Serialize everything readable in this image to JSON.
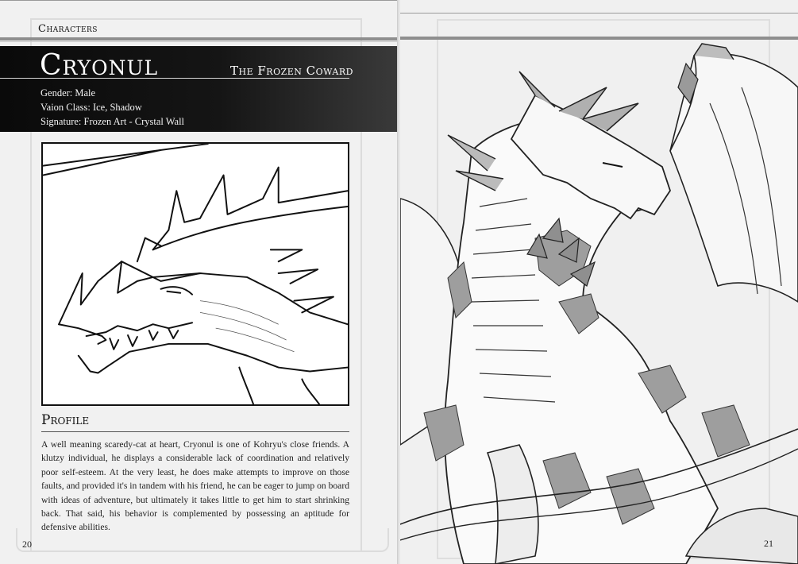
{
  "left_page": {
    "section": "Characters",
    "character": {
      "name": "Cryonul",
      "epithet": "The Frozen Coward",
      "details": [
        "Gender: Male",
        "Vaion Class: Ice, Shadow",
        "Signature: Frozen Art - Crystal Wall"
      ]
    },
    "profile": {
      "heading": "Profile",
      "text": "A well meaning scaredy-cat at heart, Cryonul is one of Kohryu's close friends. A klutzy individual, he displays a considerable lack of coordination and relatively poor self-esteem. At the very least, he does make attempts to improve on those faults, and provided it's in tandem with his friend, he can be eager to jump on board with ideas of adventure, but ultimately it takes little to get him to start shrinking back. That said, his behavior is complemented by possessing an aptitude for defensive abilities."
    },
    "page_number": "20"
  },
  "right_page": {
    "page_number": "21"
  },
  "colors": {
    "banner": "#111111",
    "page": "#f1f1f1",
    "rule": "#8e8e8e",
    "ink": "#1a1a1a"
  }
}
